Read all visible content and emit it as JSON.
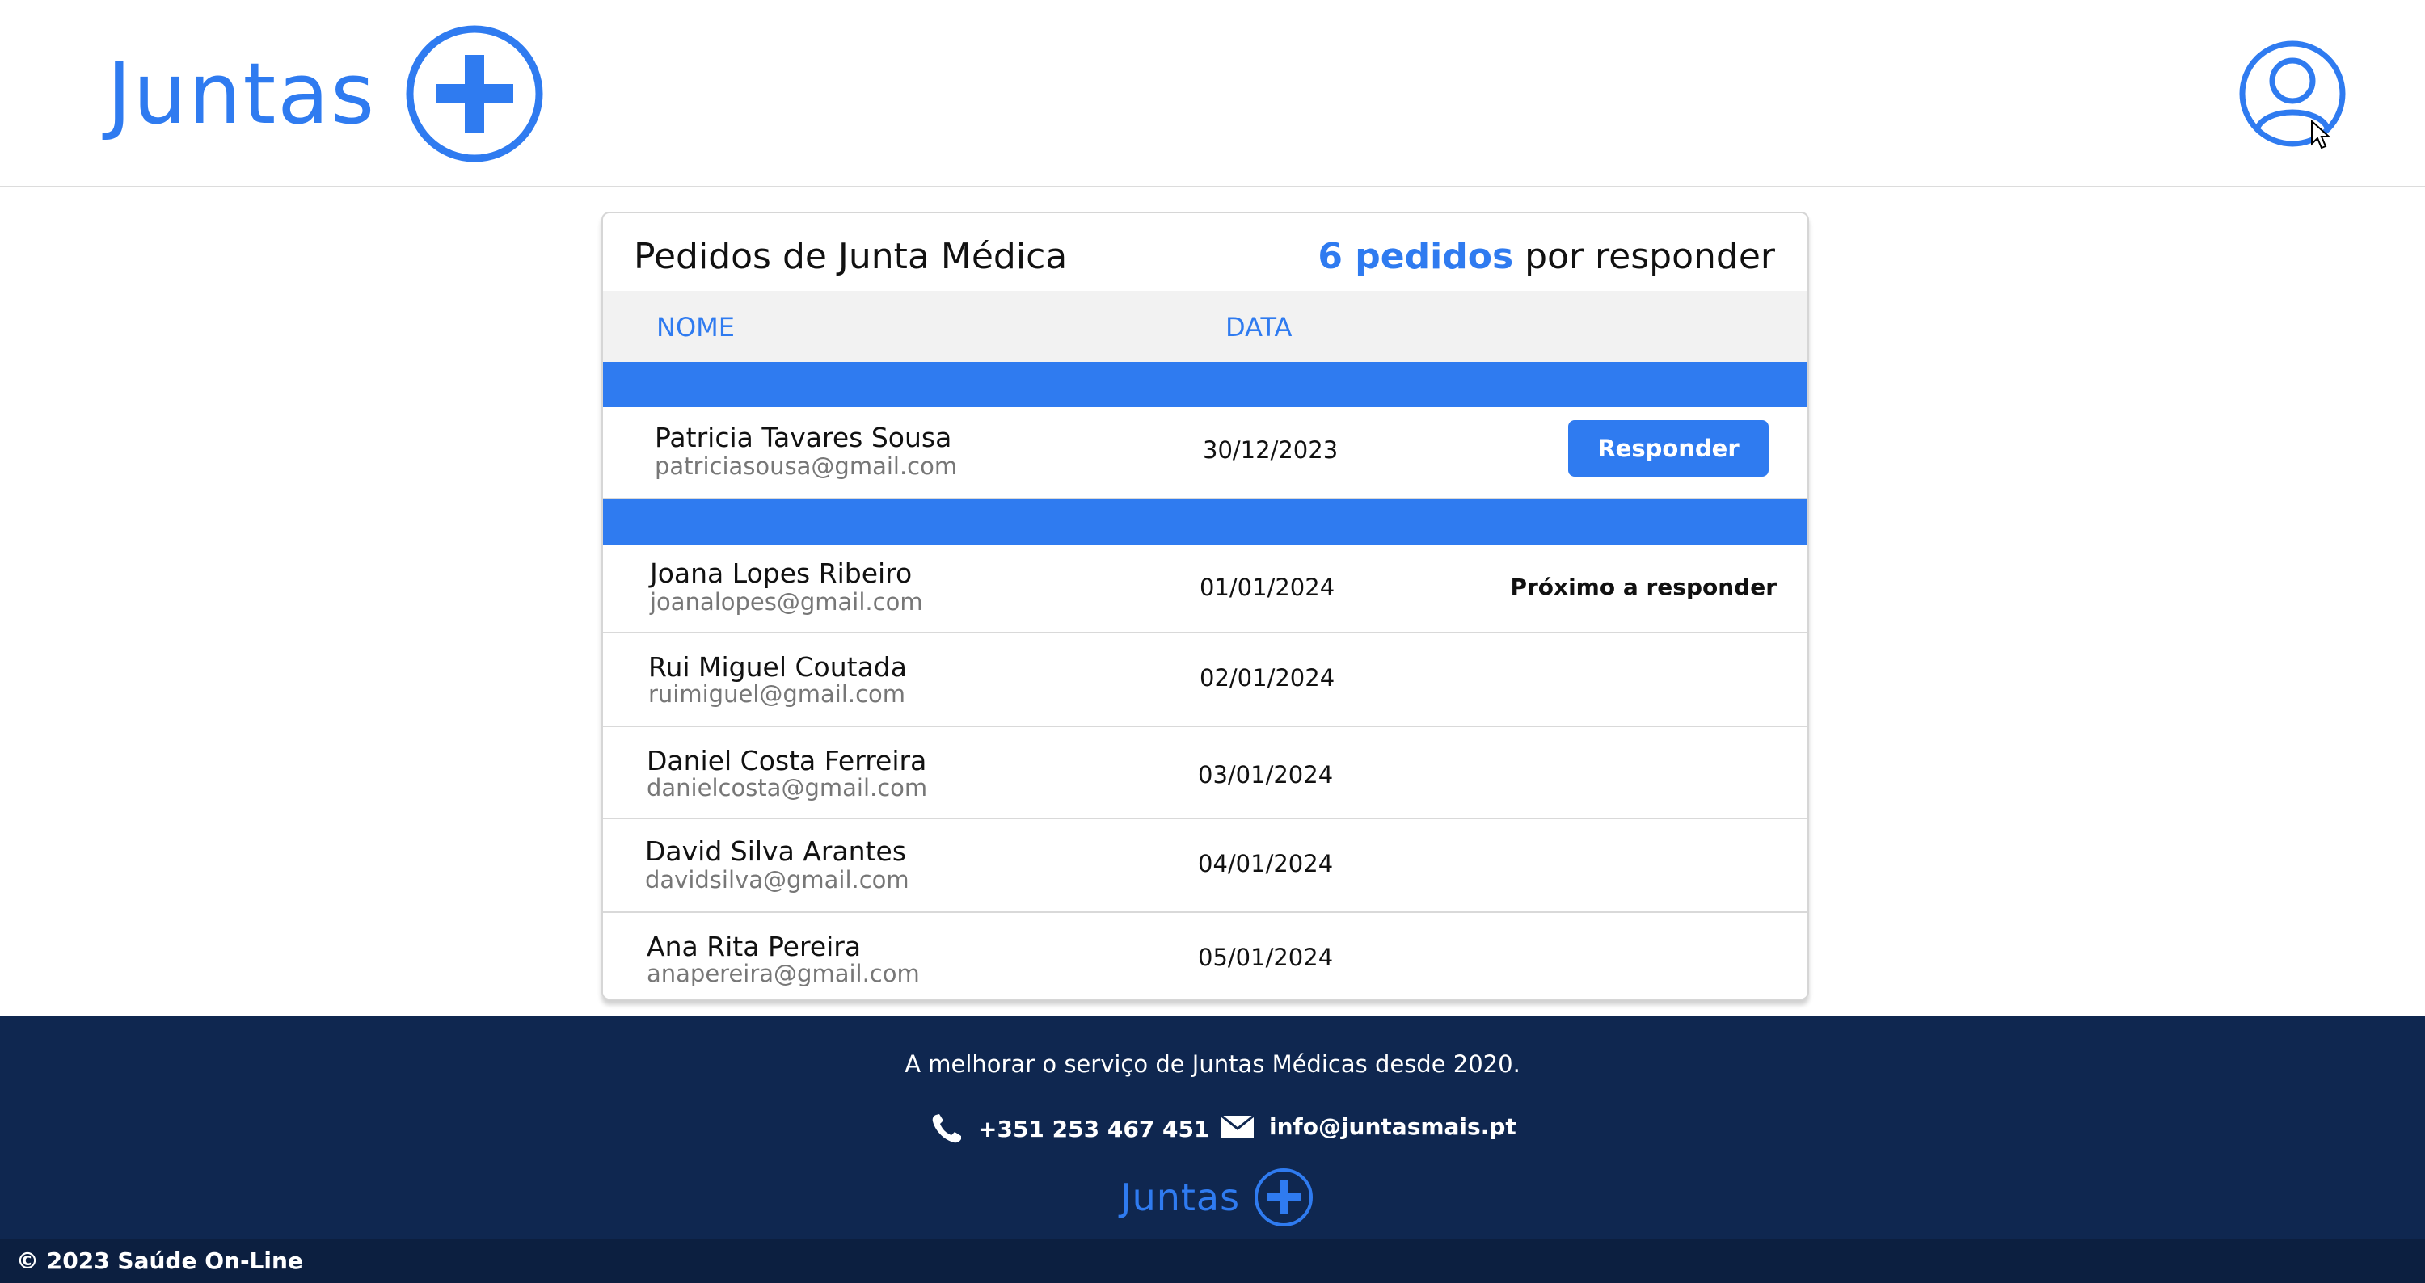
{
  "header": {
    "logo_text": "Juntas",
    "profile_icon": "user-circle-icon"
  },
  "card": {
    "title": "Pedidos de Junta Médica",
    "count_number": "6 pedidos",
    "count_suffix": " por responder",
    "columns": {
      "name": "NOME",
      "date": "DATA"
    },
    "respond_label": "Responder",
    "next_label": "Próximo a responder",
    "rows": [
      {
        "name": "Patricia Tavares Sousa",
        "email": "patriciasousa@gmail.com",
        "date": "30/12/2023"
      },
      {
        "name": "Joana Lopes Ribeiro",
        "email": "joanalopes@gmail.com",
        "date": "01/01/2024"
      },
      {
        "name": "Rui Miguel Coutada",
        "email": "ruimiguel@gmail.com",
        "date": "02/01/2024"
      },
      {
        "name": "Daniel Costa Ferreira",
        "email": "danielcosta@gmail.com",
        "date": "03/01/2024"
      },
      {
        "name": "David Silva Arantes",
        "email": "davidsilva@gmail.com",
        "date": "04/01/2024"
      },
      {
        "name": "Ana Rita Pereira",
        "email": "anapereira@gmail.com",
        "date": "05/01/2024"
      }
    ]
  },
  "footer": {
    "tagline": "A melhorar o serviço de Juntas Médicas desde 2020.",
    "phone": "+351 253 467 451",
    "email": "info@juntasmais.pt",
    "logo_text": "Juntas",
    "copyright": "© 2023 Saúde On-Line"
  },
  "colors": {
    "accent": "#2f7bf0",
    "footer_bg": "#0f2750",
    "copyright_bg": "#0c1f40"
  }
}
